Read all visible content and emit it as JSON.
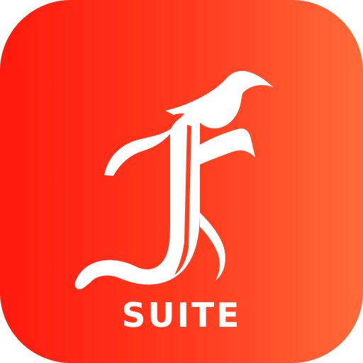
{
  "icon": {
    "label": "SUITE",
    "letter_mark": "F",
    "background_gradient": [
      "#ff1a0e",
      "#ff6a3a"
    ],
    "foreground_color": "#ffffff",
    "logo_icon": "blackletter-f-icon"
  }
}
